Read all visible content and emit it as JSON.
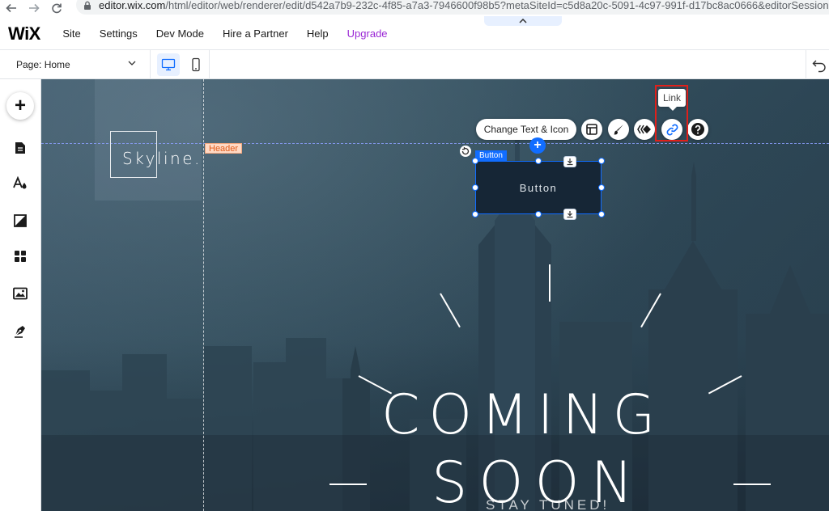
{
  "browser": {
    "url_host": "editor.wix.com",
    "url_path": "/html/editor/web/renderer/edit/d542a7b9-232c-4f85-a7a3-7946600f98b5?metaSiteId=c5d8a20c-5091-4c97-991f-d17bc8ac0666&editorSessionId=6db9a807-ac"
  },
  "topbar": {
    "logo": "WiX",
    "menu": [
      "Site",
      "Settings",
      "Dev Mode",
      "Hire a Partner",
      "Help",
      "Upgrade"
    ]
  },
  "subbar": {
    "page_label": "Page: Home"
  },
  "canvas": {
    "logo_text": "Skyline.",
    "header_tag": "Header",
    "toolbar": {
      "change_text_label": "Change Text & Icon",
      "tooltip": "Link"
    },
    "selected_tag": "Button",
    "button_label": "Button",
    "headline_line1": "COMING",
    "headline_line2": "SOON",
    "tagline": "STAY TUNED!"
  },
  "colors": {
    "wix_blue": "#116dff",
    "upgrade_purple": "#9a27d5",
    "highlight_red": "#e0201b",
    "header_tag_orange": "#e05a1a"
  }
}
